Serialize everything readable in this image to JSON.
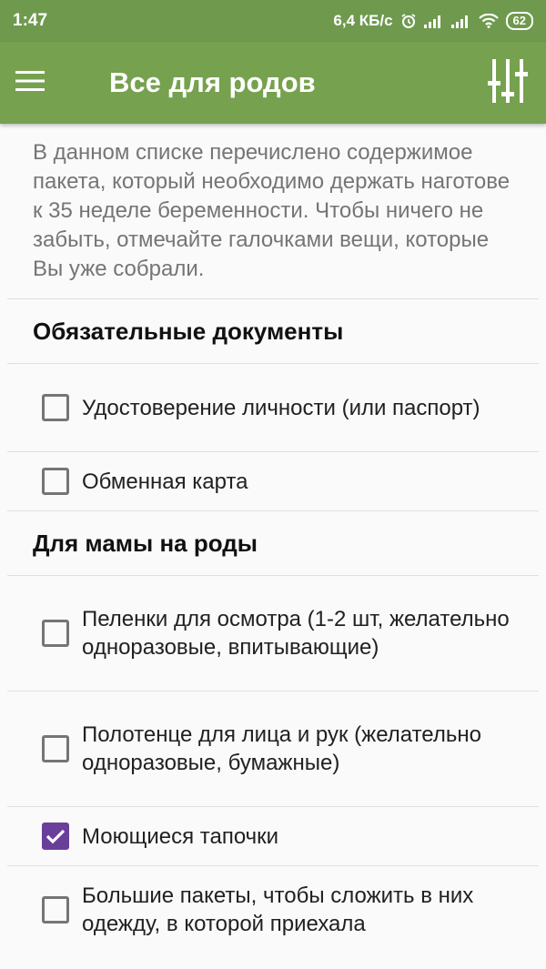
{
  "status_bar": {
    "time": "1:47",
    "speed": "6,4 КБ/с",
    "battery": "62",
    "icons": [
      "alarm-icon",
      "signal-icon",
      "signal-icon",
      "wifi-icon",
      "battery-icon"
    ]
  },
  "app_bar": {
    "title": "Все для родов",
    "menu_icon": "menu-icon",
    "filter_icon": "tune-icon"
  },
  "colors": {
    "status_bar": "#6f9a4e",
    "app_bar": "#76a14f",
    "checkbox_checked": "#6a3f9a"
  },
  "intro": "В данном списке перечислено содержимое пакета, который необходимо держать наготове к 35 неделе беременности. Чтобы ничего не забыть, отмечайте галочками вещи, которые Вы уже собрали.",
  "sections": [
    {
      "title": "Обязательные документы",
      "items": [
        {
          "label": "Удостоверение личности (или паспорт)",
          "checked": false
        },
        {
          "label": "Обменная карта",
          "checked": false
        }
      ]
    },
    {
      "title": "Для мамы на роды",
      "items": [
        {
          "label": "Пеленки для осмотра (1-2 шт, желательно одноразовые, впитывающие)",
          "checked": false
        },
        {
          "label": "Полотенце для лица и рук (желательно одноразовые, бумажные)",
          "checked": false
        },
        {
          "label": "Моющиеся тапочки",
          "checked": true
        },
        {
          "label": "Большие пакеты, чтобы сложить в них одежду, в которой приехала",
          "checked": false
        }
      ]
    }
  ]
}
